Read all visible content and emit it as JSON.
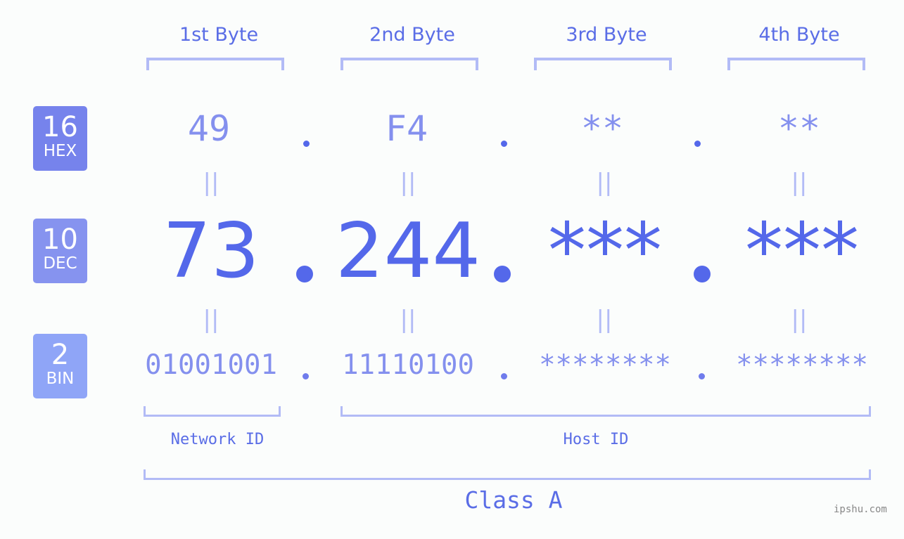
{
  "headers": [
    "1st Byte",
    "2nd Byte",
    "3rd Byte",
    "4th Byte"
  ],
  "rows": {
    "hex": {
      "base": "16",
      "label": "HEX",
      "values": [
        "49",
        "F4",
        "**",
        "**"
      ],
      "color": "#7683ec"
    },
    "dec": {
      "base": "10",
      "label": "DEC",
      "values": [
        "73",
        "244",
        "***",
        "***"
      ],
      "color": "#8693ef"
    },
    "bin": {
      "base": "2",
      "label": "BIN",
      "values": [
        "01001001",
        "11110100",
        "********",
        "********"
      ],
      "color": "#8fa5f7"
    }
  },
  "equals_sign": "||",
  "network_label": "Network ID",
  "host_label": "Host ID",
  "class_label": "Class A",
  "watermark": "ipshu.com",
  "accent_color": "#5468ea",
  "bracket_color": "#b2bbf6"
}
